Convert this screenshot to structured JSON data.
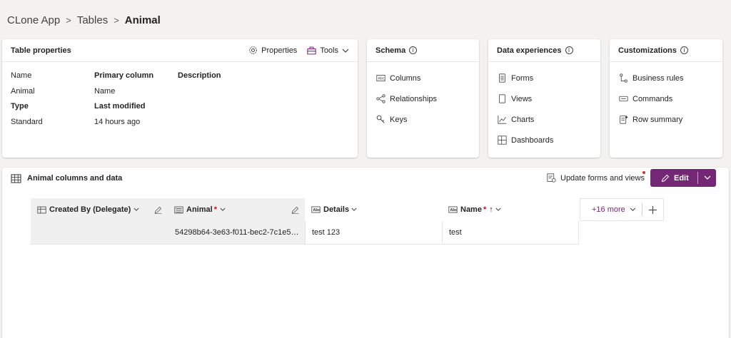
{
  "breadcrumb": {
    "app": "CLone App",
    "tables": "Tables",
    "current": "Animal"
  },
  "table_properties": {
    "title": "Table properties",
    "properties_label": "Properties",
    "tools_label": "Tools",
    "name_label": "Name",
    "name_value": "Animal",
    "type_label": "Type",
    "type_value": "Standard",
    "primary_column_label": "Primary column",
    "primary_column_value": "Name",
    "last_modified_label": "Last modified",
    "last_modified_value": "14 hours ago",
    "description_label": "Description"
  },
  "schema": {
    "title": "Schema",
    "items": [
      {
        "label": "Columns",
        "icon": "columns-icon"
      },
      {
        "label": "Relationships",
        "icon": "relationships-icon"
      },
      {
        "label": "Keys",
        "icon": "key-icon"
      }
    ]
  },
  "data_experiences": {
    "title": "Data experiences",
    "items": [
      {
        "label": "Forms",
        "icon": "form-icon"
      },
      {
        "label": "Views",
        "icon": "view-icon"
      },
      {
        "label": "Charts",
        "icon": "chart-icon"
      },
      {
        "label": "Dashboards",
        "icon": "dashboard-icon"
      }
    ]
  },
  "customizations": {
    "title": "Customizations",
    "items": [
      {
        "label": "Business rules",
        "icon": "business-rules-icon"
      },
      {
        "label": "Commands",
        "icon": "commands-icon"
      },
      {
        "label": "Row summary",
        "icon": "row-summary-icon"
      }
    ]
  },
  "columns_data": {
    "title": "Animal columns and data",
    "update_label": "Update forms and views",
    "edit_label": "Edit",
    "more_label": "+16 more",
    "columns": [
      {
        "label": "Created By (Delegate)",
        "required": false,
        "sort": ""
      },
      {
        "label": "Animal",
        "required": true,
        "sort": ""
      },
      {
        "label": "Details",
        "required": false,
        "sort": ""
      },
      {
        "label": "Name",
        "required": true,
        "sort": "↑"
      }
    ],
    "rows": [
      [
        "",
        "54298b64-3e63-f011-bec2-7c1e5…",
        "test 123",
        "test"
      ]
    ]
  },
  "colors": {
    "accent": "#742774",
    "required": "#c50f1f",
    "notification_dot": "#d13438"
  }
}
